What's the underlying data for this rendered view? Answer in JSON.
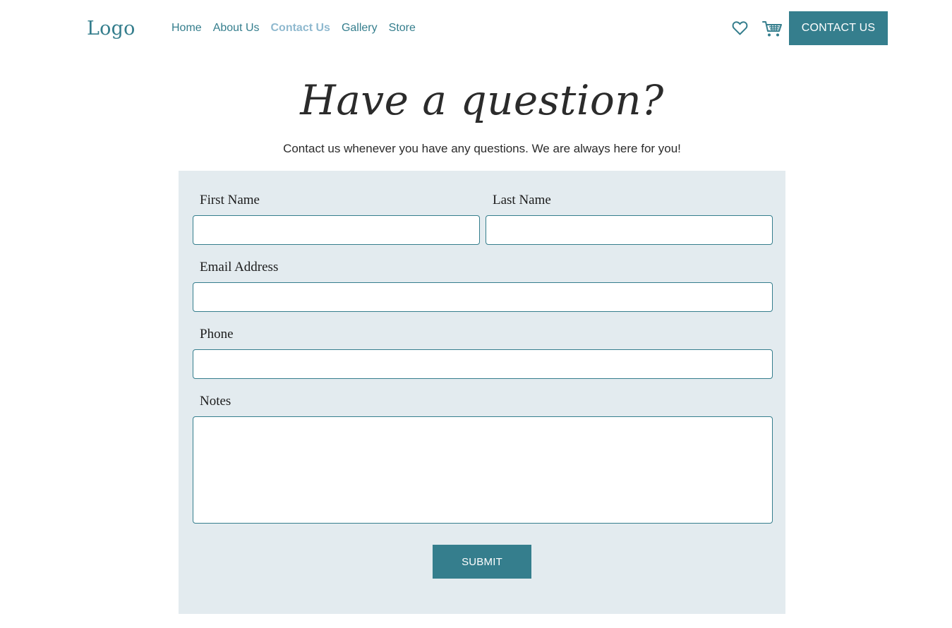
{
  "header": {
    "logo": "Logo",
    "nav": [
      {
        "label": "Home",
        "active": false
      },
      {
        "label": "About Us",
        "active": false
      },
      {
        "label": "Contact Us",
        "active": true
      },
      {
        "label": "Gallery",
        "active": false
      },
      {
        "label": "Store",
        "active": false
      }
    ],
    "icons": [
      "heart-icon",
      "cart-icon"
    ],
    "contact_button": "CONTACT US"
  },
  "hero": {
    "title": "Have a question?",
    "subtitle": "Contact us whenever you have any questions. We are always here for you!"
  },
  "form": {
    "first_name_label": "First Name",
    "first_name_value": "",
    "last_name_label": "Last Name",
    "last_name_value": "",
    "email_label": "Email Address",
    "email_value": "",
    "phone_label": "Phone",
    "phone_value": "",
    "notes_label": "Notes",
    "notes_value": "",
    "submit_label": "SUBMIT"
  },
  "colors": {
    "accent": "#357e8d",
    "nav_active": "#8fb9cf",
    "panel_bg": "#e3ebef",
    "text": "#2b2b2b"
  }
}
